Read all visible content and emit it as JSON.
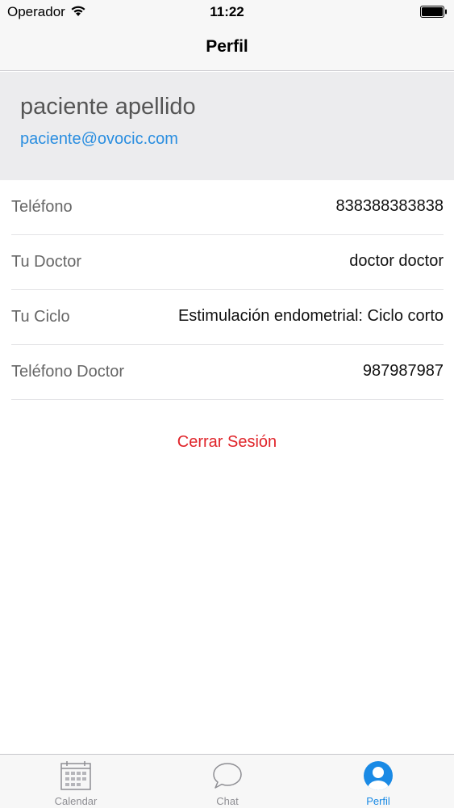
{
  "status_bar": {
    "carrier": "Operador",
    "time": "11:22"
  },
  "nav": {
    "title": "Perfil"
  },
  "profile": {
    "name": "paciente apellido",
    "email": "paciente@ovocic.com"
  },
  "info": [
    {
      "label": "Teléfono",
      "value": "838388383838"
    },
    {
      "label": "Tu Doctor",
      "value": "doctor doctor"
    },
    {
      "label": "Tu Ciclo",
      "value": "Estimulación endometrial: Ciclo corto"
    },
    {
      "label": "Teléfono Doctor",
      "value": "987987987"
    }
  ],
  "logout_label": "Cerrar Sesión",
  "tabs": [
    {
      "label": "Calendar",
      "icon": "calendar-icon"
    },
    {
      "label": "Chat",
      "icon": "chat-bubble-icon"
    },
    {
      "label": "Perfil",
      "icon": "profile-icon",
      "active": true
    }
  ],
  "colors": {
    "accent": "#1a8ae5",
    "email_link": "#2a8ee0",
    "logout": "#e0242a",
    "header_bg": "#ececee"
  }
}
